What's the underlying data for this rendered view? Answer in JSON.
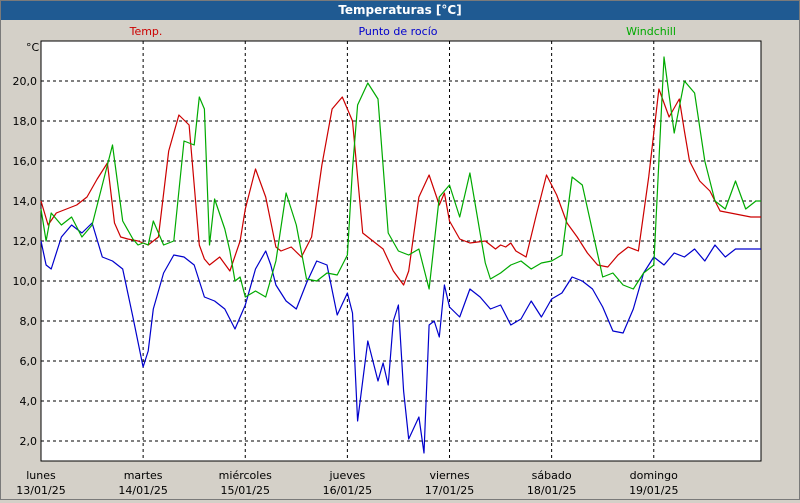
{
  "window": {
    "title": "Temperaturas [°C]"
  },
  "chart_data": {
    "type": "line",
    "title": "Temperaturas [°C]",
    "ylabel": "°C",
    "ylim": [
      1.0,
      22.0
    ],
    "xlim": [
      0,
      7.05
    ],
    "y_ticks": [
      "2,0",
      "4,0",
      "6,0",
      "8,0",
      "10,0",
      "12,0",
      "14,0",
      "16,0",
      "18,0",
      "20,0"
    ],
    "y_tick_values": [
      2,
      4,
      6,
      8,
      10,
      12,
      14,
      16,
      18,
      20
    ],
    "days": [
      {
        "weekday": "lunes",
        "date": "13/01/25"
      },
      {
        "weekday": "martes",
        "date": "14/01/25"
      },
      {
        "weekday": "miércoles",
        "date": "15/01/25"
      },
      {
        "weekday": "jueves",
        "date": "16/01/25"
      },
      {
        "weekday": "viernes",
        "date": "17/01/25"
      },
      {
        "weekday": "sábado",
        "date": "18/01/25"
      },
      {
        "weekday": "domingo",
        "date": "19/01/25"
      }
    ],
    "grid": true,
    "legend_position": "top",
    "series": [
      {
        "name": "Temp.",
        "color": "#cc0000",
        "x": [
          0,
          0.07,
          0.15,
          0.25,
          0.35,
          0.45,
          0.55,
          0.65,
          0.72,
          0.78,
          0.85,
          0.95,
          1.05,
          1.15,
          1.25,
          1.35,
          1.45,
          1.55,
          1.6,
          1.65,
          1.75,
          1.85,
          1.95,
          2.0,
          2.1,
          2.2,
          2.3,
          2.35,
          2.45,
          2.55,
          2.65,
          2.75,
          2.85,
          2.95,
          3.05,
          3.15,
          3.25,
          3.35,
          3.45,
          3.55,
          3.6,
          3.7,
          3.8,
          3.9,
          3.95,
          4.0,
          4.1,
          4.2,
          4.35,
          4.45,
          4.5,
          4.55,
          4.6,
          4.65,
          4.75,
          4.85,
          4.95,
          5.05,
          5.15,
          5.25,
          5.35,
          5.45,
          5.55,
          5.65,
          5.75,
          5.85,
          5.95,
          6.05,
          6.15,
          6.25,
          6.3,
          6.35,
          6.45,
          6.55,
          6.65,
          6.75,
          6.85,
          6.95,
          7.05
        ],
        "values": [
          14.0,
          12.8,
          13.4,
          13.6,
          13.8,
          14.2,
          15.1,
          15.9,
          12.9,
          12.2,
          12.1,
          12.0,
          11.8,
          12.2,
          16.5,
          18.3,
          17.8,
          11.8,
          11.1,
          10.8,
          11.2,
          10.5,
          12.0,
          13.6,
          15.6,
          14.2,
          11.7,
          11.5,
          11.7,
          11.2,
          12.2,
          15.8,
          18.6,
          19.2,
          18.0,
          12.4,
          12.0,
          11.6,
          10.5,
          9.8,
          10.5,
          14.2,
          15.3,
          13.8,
          14.4,
          13.0,
          12.1,
          11.9,
          12.0,
          11.6,
          11.8,
          11.7,
          11.9,
          11.5,
          11.2,
          13.3,
          15.3,
          14.3,
          12.9,
          12.2,
          11.4,
          10.8,
          10.7,
          11.3,
          11.7,
          11.5,
          15.2,
          19.6,
          18.2,
          19.1,
          17.5,
          16.0,
          15.0,
          14.5,
          13.5,
          13.4,
          13.3,
          13.2,
          13.2
        ]
      },
      {
        "name": "Punto de rocío",
        "color": "#0000cc",
        "x": [
          0,
          0.05,
          0.1,
          0.2,
          0.3,
          0.4,
          0.5,
          0.6,
          0.7,
          0.8,
          0.9,
          1.0,
          1.05,
          1.1,
          1.2,
          1.3,
          1.4,
          1.5,
          1.6,
          1.7,
          1.8,
          1.9,
          2.0,
          2.1,
          2.2,
          2.25,
          2.3,
          2.4,
          2.5,
          2.6,
          2.7,
          2.8,
          2.9,
          3.0,
          3.05,
          3.1,
          3.2,
          3.3,
          3.35,
          3.4,
          3.45,
          3.5,
          3.55,
          3.6,
          3.7,
          3.75,
          3.8,
          3.85,
          3.9,
          3.95,
          4.0,
          4.1,
          4.2,
          4.3,
          4.4,
          4.5,
          4.6,
          4.7,
          4.8,
          4.9,
          5.0,
          5.1,
          5.2,
          5.3,
          5.4,
          5.5,
          5.6,
          5.7,
          5.8,
          5.9,
          6.0,
          6.1,
          6.2,
          6.3,
          6.4,
          6.5,
          6.6,
          6.7,
          6.8,
          6.9,
          7.05
        ],
        "values": [
          12.0,
          10.8,
          10.6,
          12.2,
          12.8,
          12.4,
          12.9,
          11.2,
          11.0,
          10.6,
          8.2,
          5.7,
          6.5,
          8.6,
          10.4,
          11.3,
          11.2,
          10.8,
          9.2,
          9.0,
          8.6,
          7.6,
          8.8,
          10.6,
          11.5,
          10.8,
          9.8,
          9.0,
          8.6,
          9.9,
          11.0,
          10.8,
          8.3,
          9.4,
          8.4,
          3.0,
          7.0,
          5.0,
          5.9,
          4.8,
          8.0,
          8.8,
          4.5,
          2.1,
          3.2,
          1.4,
          7.8,
          8.0,
          7.2,
          9.8,
          8.7,
          8.2,
          9.6,
          9.2,
          8.6,
          8.8,
          7.8,
          8.1,
          9.0,
          8.2,
          9.1,
          9.4,
          10.2,
          10.0,
          9.6,
          8.7,
          7.5,
          7.4,
          8.6,
          10.4,
          11.2,
          10.8,
          11.4,
          11.2,
          11.6,
          11.0,
          11.8,
          11.2,
          11.6,
          11.6,
          11.6
        ]
      },
      {
        "name": "Windchill",
        "color": "#00aa00",
        "x": [
          0,
          0.05,
          0.1,
          0.2,
          0.3,
          0.4,
          0.5,
          0.6,
          0.7,
          0.8,
          0.9,
          0.95,
          1.0,
          1.05,
          1.1,
          1.2,
          1.3,
          1.4,
          1.5,
          1.55,
          1.6,
          1.65,
          1.7,
          1.8,
          1.85,
          1.9,
          1.95,
          2.0,
          2.1,
          2.2,
          2.3,
          2.4,
          2.5,
          2.6,
          2.7,
          2.8,
          2.9,
          3.0,
          3.05,
          3.1,
          3.2,
          3.3,
          3.4,
          3.5,
          3.6,
          3.7,
          3.75,
          3.8,
          3.9,
          4.0,
          4.1,
          4.2,
          4.3,
          4.35,
          4.4,
          4.5,
          4.6,
          4.7,
          4.8,
          4.9,
          5.0,
          5.1,
          5.2,
          5.3,
          5.4,
          5.5,
          5.6,
          5.7,
          5.8,
          5.9,
          6.0,
          6.1,
          6.2,
          6.3,
          6.4,
          6.5,
          6.6,
          6.7,
          6.8,
          6.9,
          7.0,
          7.05
        ],
        "values": [
          13.6,
          12.0,
          13.4,
          12.8,
          13.2,
          12.2,
          12.8,
          14.8,
          16.8,
          13.0,
          12.1,
          11.8,
          11.9,
          11.8,
          13.0,
          11.8,
          12.0,
          17.0,
          16.8,
          19.2,
          18.6,
          11.8,
          14.1,
          12.6,
          11.5,
          10.0,
          10.2,
          9.2,
          9.5,
          9.2,
          11.0,
          14.4,
          12.8,
          10.1,
          10.0,
          10.4,
          10.3,
          11.3,
          15.6,
          18.8,
          19.9,
          19.1,
          12.4,
          11.5,
          11.3,
          11.6,
          10.6,
          9.6,
          14.2,
          14.8,
          13.2,
          15.4,
          12.4,
          10.9,
          10.1,
          10.4,
          10.8,
          11.0,
          10.6,
          10.9,
          11.0,
          11.3,
          15.2,
          14.8,
          12.5,
          10.2,
          10.4,
          9.8,
          9.6,
          10.4,
          10.8,
          21.2,
          17.4,
          20.0,
          19.4,
          16.0,
          14.0,
          13.6,
          15.0,
          13.6,
          14.0,
          14.0
        ]
      }
    ]
  }
}
